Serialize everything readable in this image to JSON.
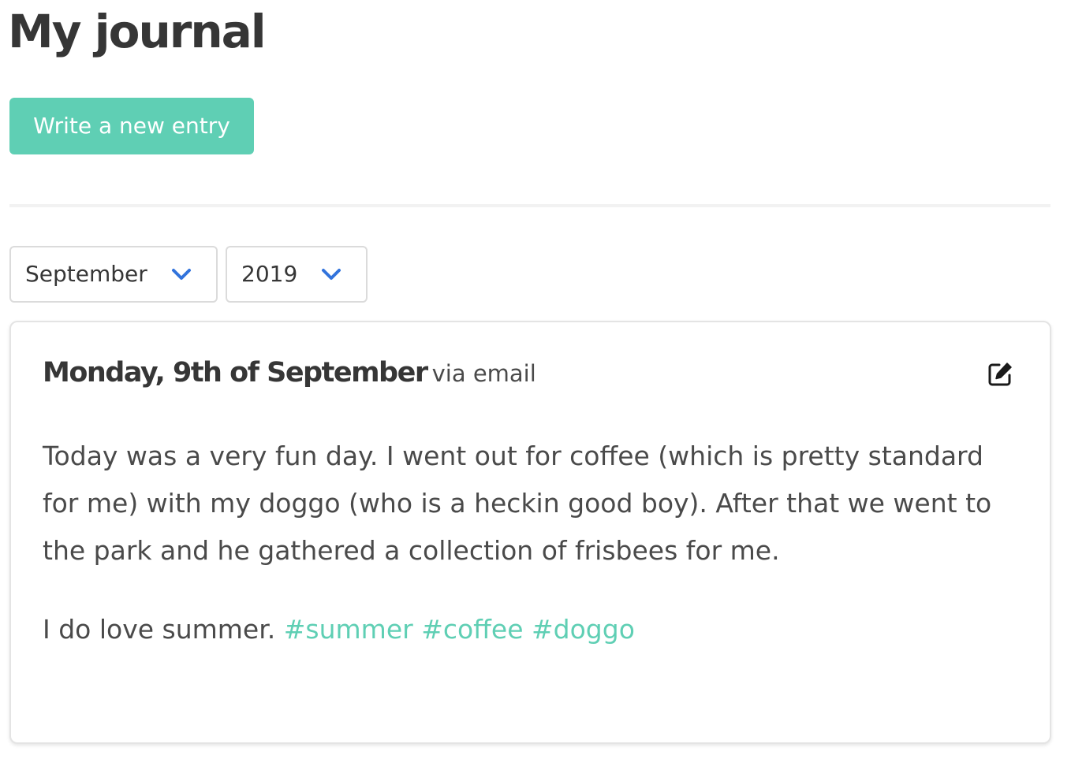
{
  "header": {
    "title": "My journal",
    "new_entry_label": "Write a new entry"
  },
  "filters": {
    "month": {
      "selected": "September"
    },
    "year": {
      "selected": "2019"
    }
  },
  "entry": {
    "date": "Monday, 9th of September",
    "source": "via email",
    "paragraph_1": "Today was a very fun day. I went out for coffee (which is pretty standard for me) with my doggo (who is a heckin good boy). After that we went to the park and he gathered a collection of frisbees for me.",
    "paragraph_2_text": "I do love summer.",
    "tags": [
      "#summer",
      "#coffee",
      "#doggo"
    ],
    "edit_icon": "edit-icon"
  },
  "colors": {
    "accent": "#5fcfb4",
    "chevron": "#3273dc",
    "text": "#363636",
    "border": "#dbdbdb"
  }
}
